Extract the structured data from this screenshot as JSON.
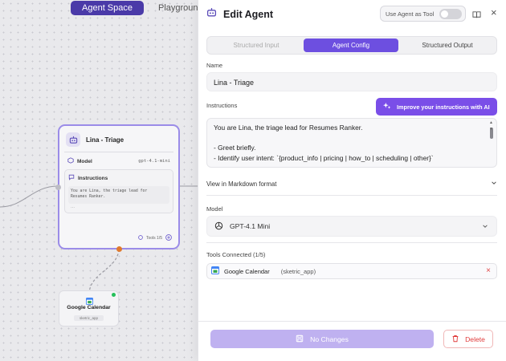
{
  "canvas": {
    "tabs": [
      {
        "label": "Agent Space",
        "active": true
      },
      {
        "label": "Playground",
        "active": false
      }
    ],
    "agent_node": {
      "title": "Lina - Triage",
      "model_label": "Model",
      "model_value": "gpt-4.1-mini",
      "instructions_label": "Instructions",
      "instructions_preview_1": "You are Lina, the triage lead for",
      "instructions_preview_2": "Resumes Ranker.",
      "instructions_more": "...",
      "tools_count": "Tools 1/5"
    },
    "tool_node": {
      "title": "Google Calendar",
      "package": "sketric_app",
      "status": "connected"
    }
  },
  "panel": {
    "title": "Edit Agent",
    "use_as_tool_label": "Use Agent as Tool",
    "use_as_tool_enabled": false,
    "tabs": [
      {
        "label": "Structured Input",
        "active": false
      },
      {
        "label": "Agent Config",
        "active": true
      },
      {
        "label": "Structured Output",
        "active": false
      }
    ],
    "name_label": "Name",
    "name_value": "Lina - Triage",
    "instructions_label": "Instructions",
    "improve_button": "Improve your instructions with AI",
    "instructions_lines": [
      "You are Lina, the triage lead for Resumes Ranker.",
      "",
      "- Greet briefly.",
      "- Identify user intent: `{product_info | pricing | how_to | scheduling | other}`"
    ],
    "markdown_toggle": "View in Markdown format",
    "model_label": "Model",
    "model_value": "GPT-4.1 Mini",
    "tools_label": "Tools Connected (1/5)",
    "tools": [
      {
        "name": "Google Calendar",
        "package": "(sketric_app)"
      }
    ],
    "save_button": "No Changes",
    "save_enabled": false,
    "delete_button": "Delete"
  },
  "colors": {
    "accent": "#6d4fe0",
    "accent_light": "#bfb1f0",
    "danger": "#e03c3c",
    "node_border": "#9b8ce8",
    "connector": "#e07a2e",
    "status_green": "#25c05a"
  }
}
